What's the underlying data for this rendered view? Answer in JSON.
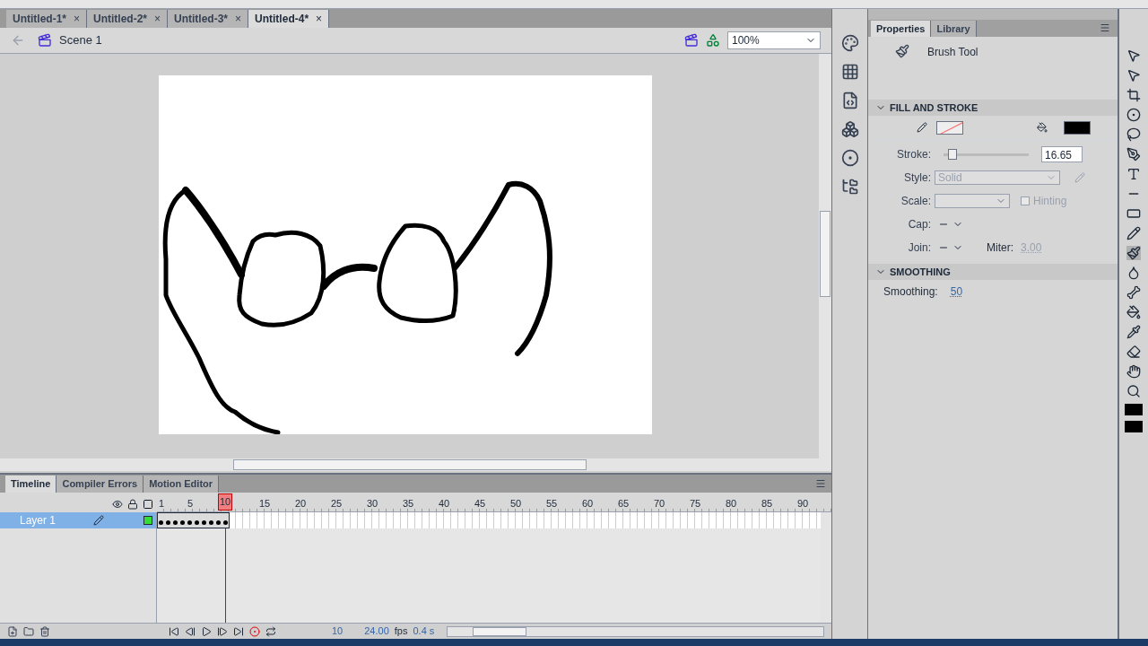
{
  "document_tabs": [
    {
      "label": "Untitled-1*",
      "selected": false
    },
    {
      "label": "Untitled-2*",
      "selected": false
    },
    {
      "label": "Untitled-3*",
      "selected": false
    },
    {
      "label": "Untitled-4*",
      "selected": true
    }
  ],
  "close_glyph": "×",
  "edit_bar": {
    "scene": "Scene 1",
    "zoom": "100%"
  },
  "panel_tabs": [
    {
      "label": "Properties",
      "selected": true
    },
    {
      "label": "Library",
      "selected": false
    }
  ],
  "properties": {
    "tool": "Brush Tool",
    "fill_and_stroke": {
      "title": "FILL AND STROKE",
      "stroke": {
        "label": "Stroke:",
        "level": 0.05,
        "value": "16.65"
      },
      "style": {
        "label": "Style:",
        "value": "Solid",
        "disabled": true
      },
      "scale": {
        "label": "Scale:"
      },
      "hinting": {
        "label": "Hinting",
        "checked": false,
        "disabled": true
      },
      "cap": {
        "label": "Cap:"
      },
      "join": {
        "label": "Join:"
      },
      "miter": {
        "label": "Miter:",
        "value": "3.00"
      }
    },
    "smoothing": {
      "title": "SMOOTHING",
      "label": "Smoothing:",
      "value": "50"
    }
  },
  "timeline": {
    "tabs": [
      {
        "label": "Timeline",
        "selected": true
      },
      {
        "label": "Compiler Errors",
        "selected": false
      },
      {
        "label": "Motion Editor",
        "selected": false
      }
    ],
    "ruler": [
      "1",
      "5",
      "15",
      "20",
      "25",
      "30",
      "35",
      "40",
      "45",
      "50",
      "55",
      "60",
      "65",
      "70",
      "75",
      "80",
      "85",
      "90"
    ],
    "current_frame": "10",
    "layers": [
      {
        "name": "Layer 1",
        "selected": true
      }
    ],
    "status": {
      "frame": "10",
      "fps": "24.00",
      "fps_unit": "fps",
      "time": "0.4 s"
    }
  }
}
